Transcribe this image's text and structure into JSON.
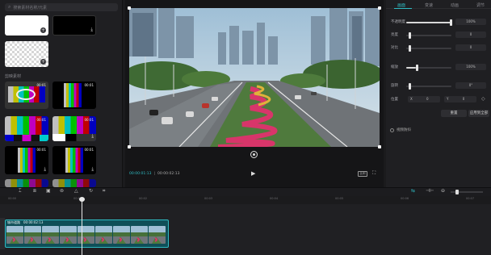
{
  "left_panel": {
    "search_placeholder": "搜索素材名称/元素",
    "section_label": "剪映素材",
    "durations": [
      "00:01",
      "00:01",
      "00:01",
      "00:01",
      "00:01",
      "00:01"
    ]
  },
  "player": {
    "time_current": "00:00:01:13",
    "time_total": "00:00:02:13",
    "ratio_label": "比例"
  },
  "right_panel": {
    "tabs": [
      "画面",
      "变速",
      "动画",
      "调节"
    ],
    "opacity_label": "不透明度",
    "opacity_value": "100%",
    "brightness_label": "亮度",
    "brightness_value": "0",
    "contrast_label": "对比",
    "contrast_value": "0",
    "scale_label": "缩放",
    "scale_value": "100%",
    "rotate_label": "旋转",
    "rotate_value": "0°",
    "position_label": "位置",
    "pos_x_label": "X",
    "pos_x_value": "0",
    "pos_y_label": "Y",
    "pos_y_value": "0",
    "reset_button": "重置",
    "apply_all_button": "应用到全部",
    "option_label": "视频防抖"
  },
  "timeline": {
    "ticks": [
      "00:00",
      "00:01",
      "00:02",
      "00:03",
      "00:04",
      "00:05",
      "00:06",
      "00:07"
    ],
    "clip_name": "城市道路",
    "clip_duration": "00:00:02:13"
  },
  "colors": {
    "accent": "#2fbcc4",
    "panel": "#1f1f22",
    "background": "#1b1b1d"
  }
}
